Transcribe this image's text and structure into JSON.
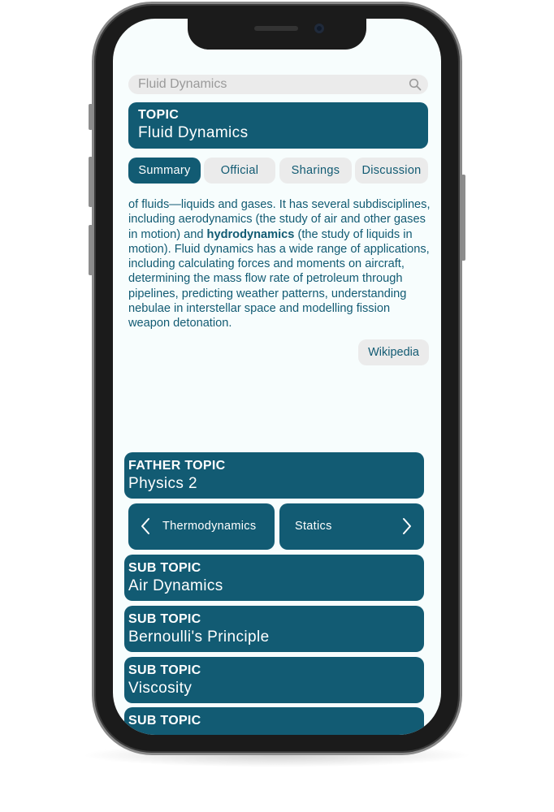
{
  "search": {
    "value": "Fluid Dynamics",
    "icon": "search-icon"
  },
  "topic": {
    "label": "TOPIC",
    "title": "Fluid Dynamics"
  },
  "tabs": [
    {
      "label": "Summary",
      "active": true
    },
    {
      "label": "Official",
      "active": false
    },
    {
      "label": "Sharings",
      "active": false
    },
    {
      "label": "Discussion",
      "active": false
    }
  ],
  "summary": {
    "text_before": " of fluids—liquids and gases. It has several subdisciplines, including aerodynamics (the study of air and other gases in motion) and ",
    "bold": "hydrodynamics",
    "text_after": " (the study of liquids in motion). Fluid dynamics has a wide range of applications, including calculating forces and moments on aircraft, determining the mass flow rate of petroleum through pipelines, predicting weather patterns, understanding nebulae in interstellar space and modelling fission weapon detonation."
  },
  "source_button": "Wikipedia",
  "father_topic": {
    "label": "FATHER TOPIC",
    "title": "Physics 2"
  },
  "siblings": {
    "prev": "Thermodynamics",
    "next": "Statics"
  },
  "sub_topics": [
    {
      "label": "SUB TOPIC",
      "title": "Air Dynamics"
    },
    {
      "label": "SUB TOPIC",
      "title": "Bernoulli's Principle"
    },
    {
      "label": "SUB TOPIC",
      "title": "Viscosity"
    },
    {
      "label": "SUB TOPIC",
      "title": ""
    }
  ],
  "colors": {
    "primary": "#125b73",
    "tab_inactive": "#ebebeb",
    "screen_bg": "#f7fdfd"
  }
}
